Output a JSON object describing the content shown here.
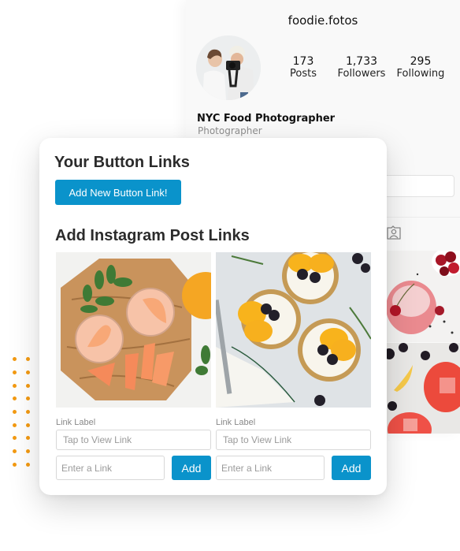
{
  "profile": {
    "username": "foodie.fotos",
    "avatar": "avatar-photo-photographers",
    "stats": [
      {
        "value": "173",
        "label": "Posts"
      },
      {
        "value": "1,733",
        "label": "Followers"
      },
      {
        "value": "295",
        "label": "Following"
      }
    ],
    "bio_name": "NYC Food Photographer",
    "bio_category": "Photographer",
    "tab_icon": "tagged-person-icon",
    "grid_photos": [
      "cherry-drink",
      "berry-lemonade"
    ]
  },
  "card": {
    "button_links_title": "Your Button Links",
    "add_button_label": "Add New Button Link!",
    "post_links_title": "Add Instagram Post Links",
    "posts": [
      {
        "photo": "grapefruit-drinks",
        "label_caption": "Link Label",
        "label_placeholder": "Tap to View Link",
        "link_placeholder": "Enter a Link",
        "add_label": "Add"
      },
      {
        "photo": "orange-tarts",
        "label_caption": "Link Label",
        "label_placeholder": "Tap to View Link",
        "link_placeholder": "Enter a Link",
        "add_label": "Add"
      }
    ]
  },
  "colors": {
    "accent": "#0a93cb",
    "dots": "#f39a12",
    "heading": "#2b2b2b"
  }
}
